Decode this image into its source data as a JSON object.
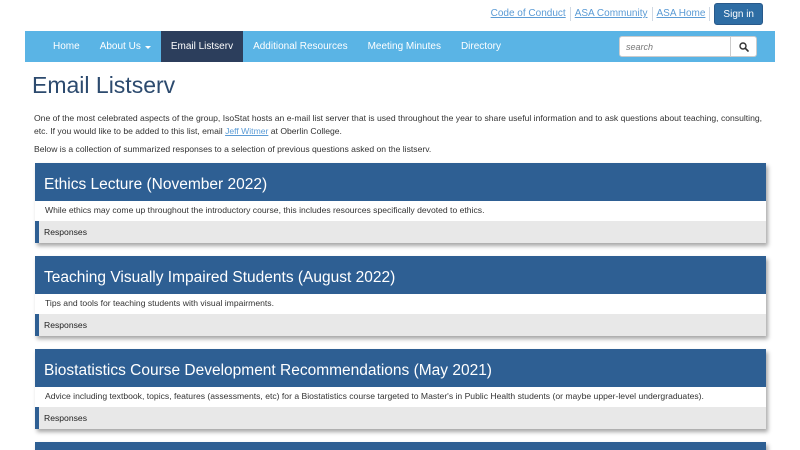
{
  "utility": {
    "links": [
      "Code of Conduct",
      "ASA Community",
      "ASA Home"
    ],
    "signin_label": "Sign in"
  },
  "nav": {
    "items": [
      {
        "label": "Home"
      },
      {
        "label": "About Us"
      },
      {
        "label": "Email Listserv"
      },
      {
        "label": "Additional Resources"
      },
      {
        "label": "Meeting Minutes"
      },
      {
        "label": "Directory"
      }
    ],
    "active_index": 2,
    "search_placeholder": "search"
  },
  "page": {
    "title": "Email Listserv",
    "intro_before": "One of the most celebrated aspects of the group, IsoStat hosts an e-mail list server that is used throughout the year to share useful information and to ask questions about teaching, consulting, etc. If you would like to be added to this list, email ",
    "intro_link": "Jeff Witmer",
    "intro_after": " at Oberlin College.",
    "lead2": "Below is a collection of summarized responses to a selection of previous questions asked on the listserv."
  },
  "cards": [
    {
      "title": "Ethics Lecture (November 2022)",
      "body": "While ethics may come up throughout the introductory course, this includes resources specifically devoted to ethics.",
      "footer": "Responses"
    },
    {
      "title": "Teaching Visually Impaired Students (August 2022)",
      "body": "Tips and tools for teaching students with visual impairments.",
      "footer": "Responses"
    },
    {
      "title": "Biostatistics Course Development Recommendations (May 2021)",
      "body": "Advice including textbook, topics, features (assessments, etc) for a Biostatistics course targeted to Master's in Public Health students (or maybe upper-level undergraduates).",
      "footer": "Responses"
    }
  ],
  "colors": {
    "nav_bg": "#5ab4e5",
    "nav_active": "#2c3e5c",
    "card_header": "#2e5f93",
    "link": "#5b9bd5",
    "signin_bg": "#2e6da4"
  }
}
